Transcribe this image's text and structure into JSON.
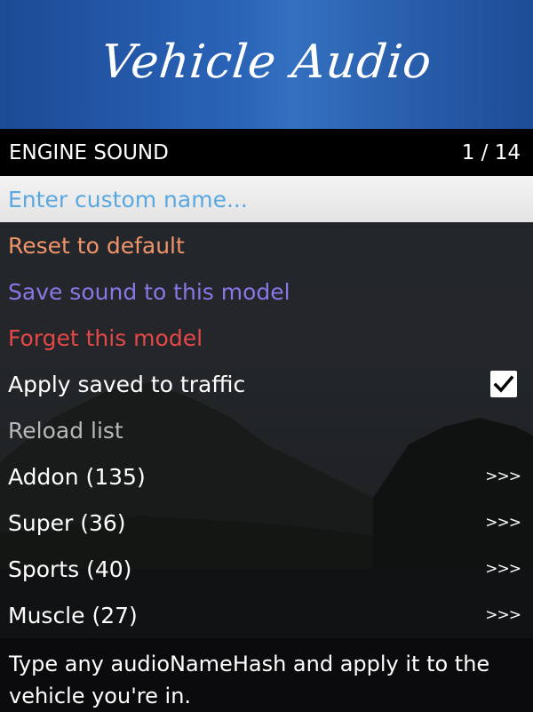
{
  "banner": {
    "title": "Vehicle Audio"
  },
  "subheader": {
    "title": "ENGINE SOUND",
    "counter": "1 / 14"
  },
  "colors": {
    "banner_blue": "#2a64b8",
    "selected_text": "#5aa8e0",
    "reset_orange": "#f0946a",
    "save_purple": "#8a76e6",
    "forget_red": "#e54848",
    "disabled_gray": "#b8b8b8"
  },
  "menu": {
    "custom_name": "Enter custom name...",
    "reset": "Reset to default",
    "save": "Save sound to this model",
    "forget": "Forget this model",
    "apply_traffic": "Apply saved to traffic",
    "apply_traffic_checked": true,
    "reload": "Reload list",
    "categories": [
      {
        "label": "Addon  (135)",
        "arrow": ">>>"
      },
      {
        "label": "Super  (36)",
        "arrow": ">>>"
      },
      {
        "label": "Sports  (40)",
        "arrow": ">>>"
      },
      {
        "label": "Muscle  (27)",
        "arrow": ">>>"
      }
    ]
  },
  "description": "Type any audioNameHash and apply it to the vehicle you're in."
}
